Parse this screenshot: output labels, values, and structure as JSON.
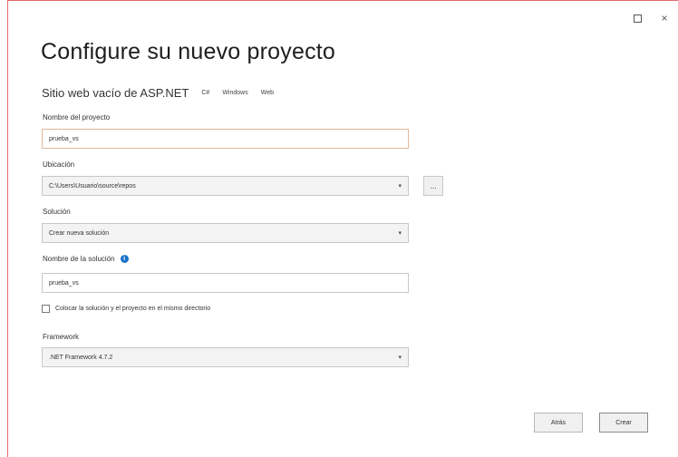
{
  "window": {
    "minimize_glyph": "",
    "maximize_icon": "maximize-icon",
    "close_glyph": "×"
  },
  "header": {
    "title": "Configure su nuevo proyecto",
    "template_name": "Sitio web vacío de ASP.NET",
    "tags": [
      "C#",
      "Windows",
      "Web"
    ]
  },
  "form": {
    "project_name": {
      "label": "Nombre del proyecto",
      "value": "prueba_vs"
    },
    "location": {
      "label": "Ubicación",
      "value": "C:\\Users\\Usuario\\source\\repos",
      "browse_label": "..."
    },
    "solution": {
      "label": "Solución",
      "value": "Crear nueva solución"
    },
    "solution_name": {
      "label": "Nombre de la solución",
      "value": "prueba_vs"
    },
    "same_directory": {
      "label": "Colocar la solución y el proyecto en el mismo directorio",
      "checked": false
    },
    "framework": {
      "label": "Framework",
      "value": ".NET Framework 4.7.2"
    }
  },
  "footer": {
    "back_label": "Atrás",
    "create_label": "Crear"
  }
}
